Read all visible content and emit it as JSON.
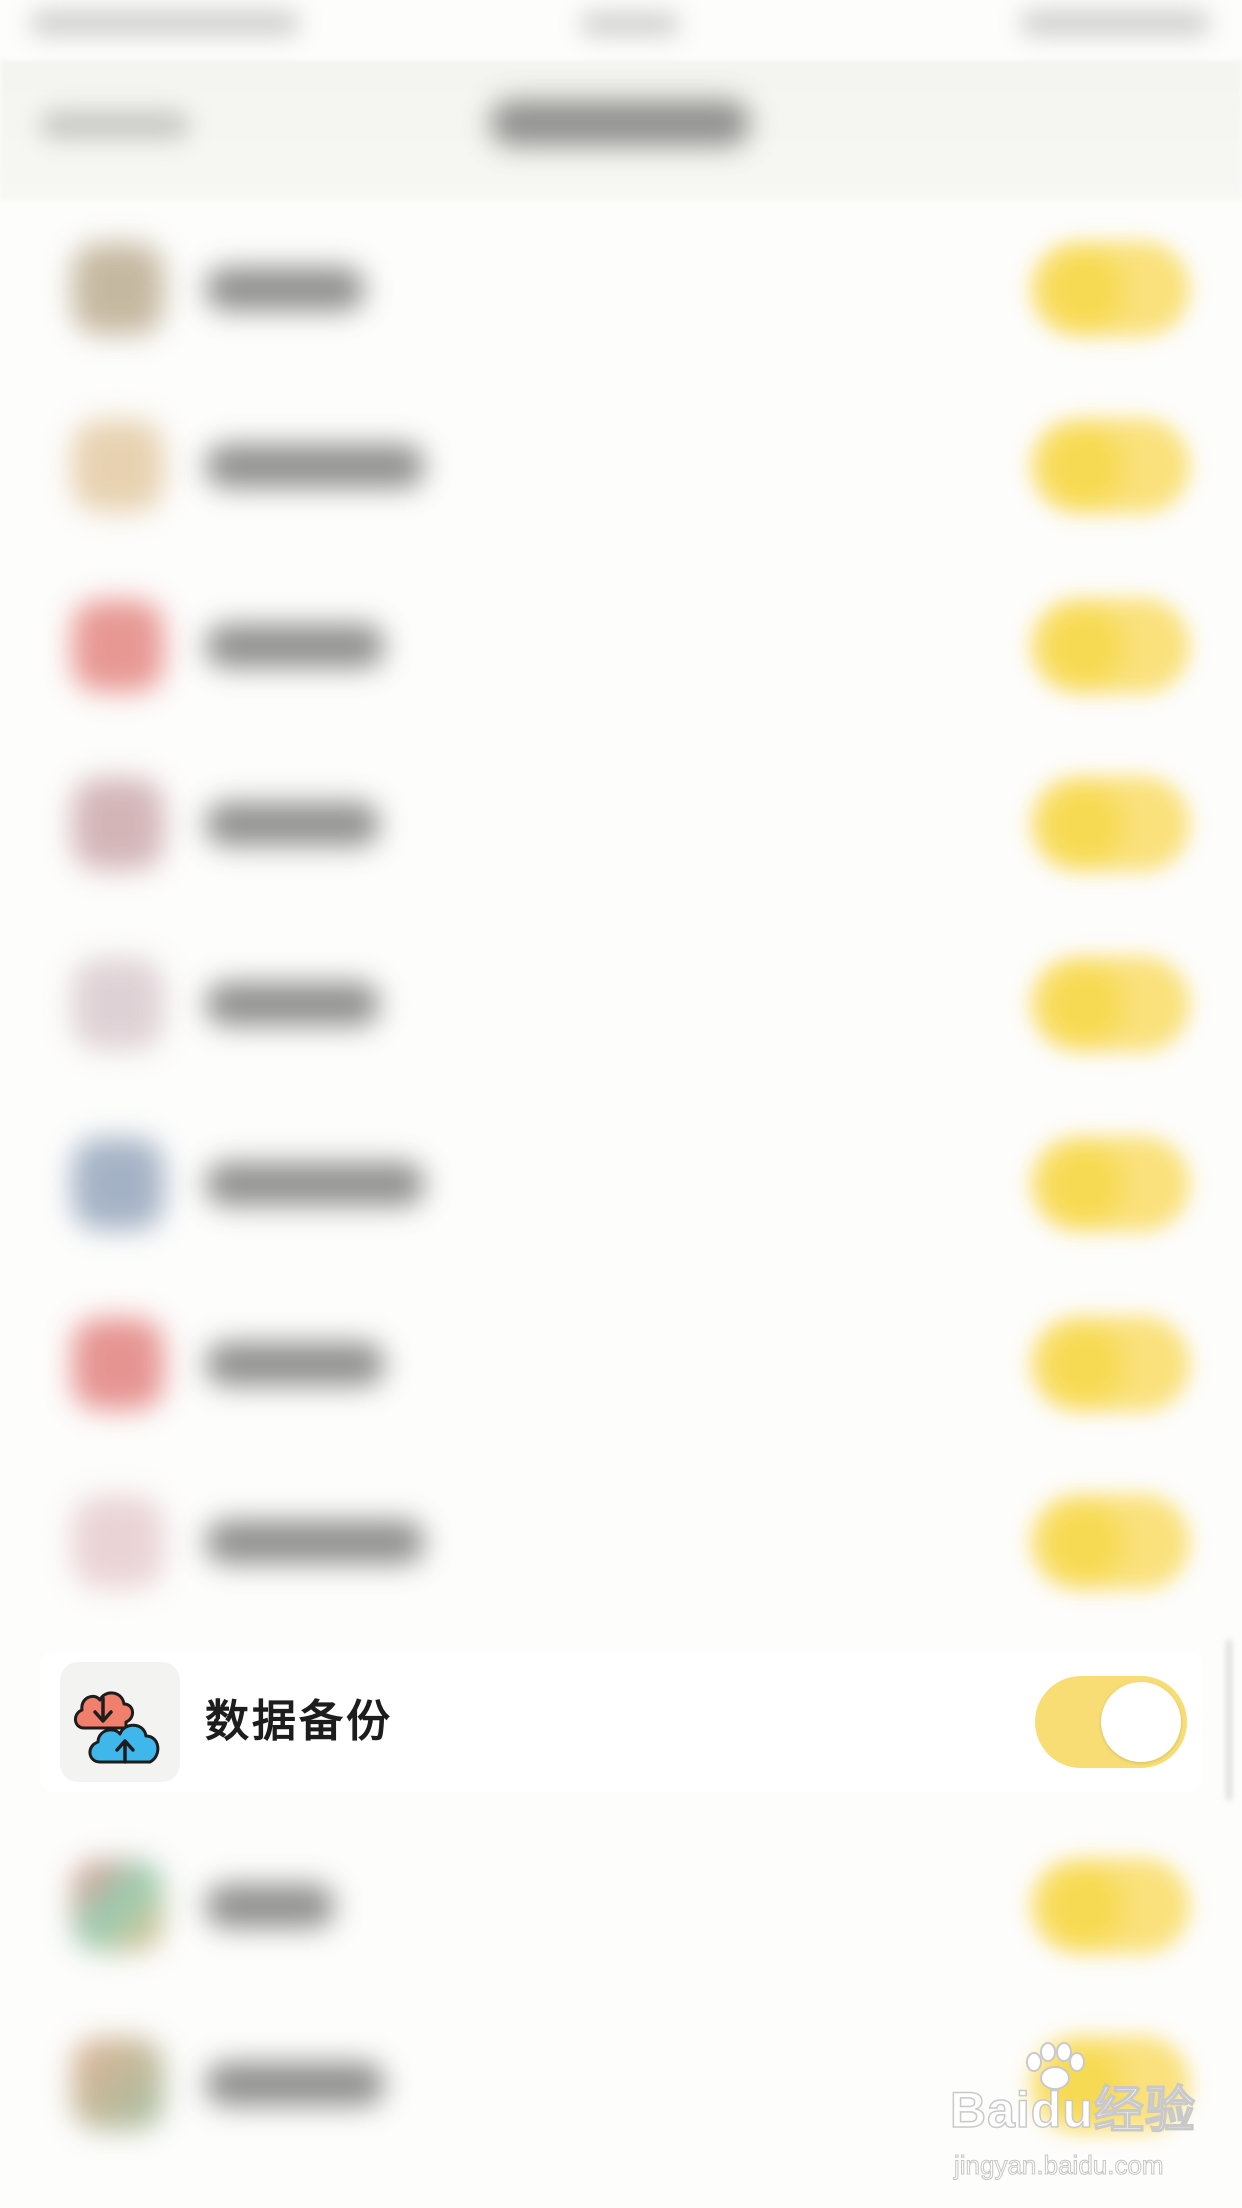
{
  "backup_row": {
    "label": "数据备份",
    "icon": "cloud-sync-icon",
    "toggle_on": true
  },
  "colors": {
    "toggle_track": "#f7dd74",
    "toggle_knob": "#ffffff",
    "cloud_red": "#f07f6b",
    "cloud_blue": "#3fb7ea",
    "background": "#fdfdfc"
  },
  "watermark": {
    "logo_text": "Baidu经验",
    "url": "jingyan.baidu.com"
  }
}
